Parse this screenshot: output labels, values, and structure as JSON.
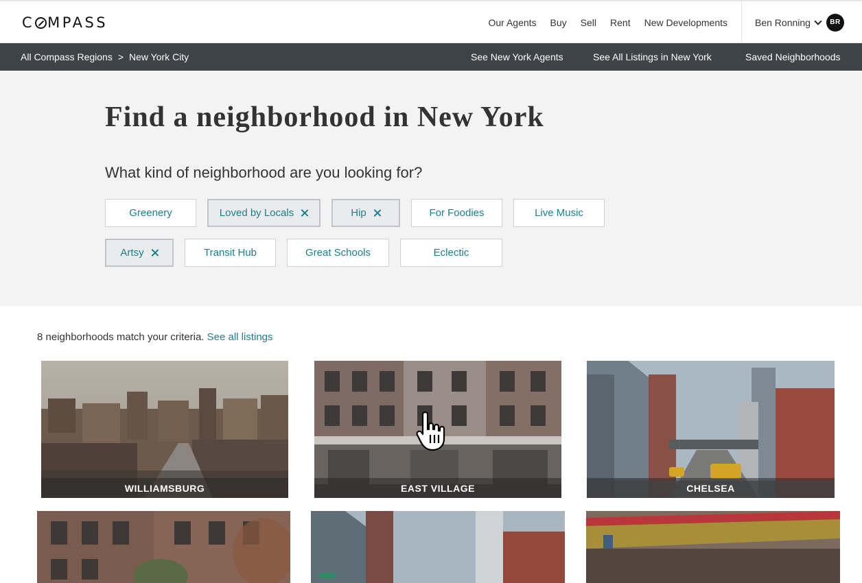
{
  "brand": {
    "logo_left": "C",
    "logo_right": "MPASS"
  },
  "nav": {
    "links": [
      "Our Agents",
      "Buy",
      "Sell",
      "Rent",
      "New Developments"
    ],
    "user_name": "Ben Ronning",
    "user_initials": "BR"
  },
  "subnav": {
    "breadcrumb": [
      "All Compass Regions",
      "New York City"
    ],
    "breadcrumb_sep": ">",
    "links": [
      "See New York Agents",
      "See All Listings in New York",
      "Saved Neighborhoods"
    ]
  },
  "hero": {
    "title": "Find a neighborhood in New York",
    "question": "What kind of neighborhood are you looking for?",
    "filters": [
      {
        "label": "Greenery",
        "selected": false
      },
      {
        "label": "Loved by Locals",
        "selected": true
      },
      {
        "label": "Hip",
        "selected": true
      },
      {
        "label": "For Foodies",
        "selected": false
      },
      {
        "label": "Live Music",
        "selected": false
      },
      {
        "label": "Artsy",
        "selected": true
      },
      {
        "label": "Transit Hub",
        "selected": false
      },
      {
        "label": "Great Schools",
        "selected": false
      },
      {
        "label": "Eclectic",
        "selected": false
      }
    ]
  },
  "results": {
    "count_text": "8 neighborhoods match your criteria.",
    "see_all_label": "See all listings",
    "neighborhoods": [
      "WILLIAMSBURG",
      "EAST VILLAGE",
      "CHELSEA"
    ]
  },
  "colors": {
    "accent": "#1a7f8e",
    "subnav_bg": "#3d4348",
    "hero_bg": "#f3f3f4",
    "chip_selected_bg": "#e9ebed"
  },
  "icons": [
    "chevron-down-icon",
    "close-icon",
    "hand-cursor-icon"
  ]
}
